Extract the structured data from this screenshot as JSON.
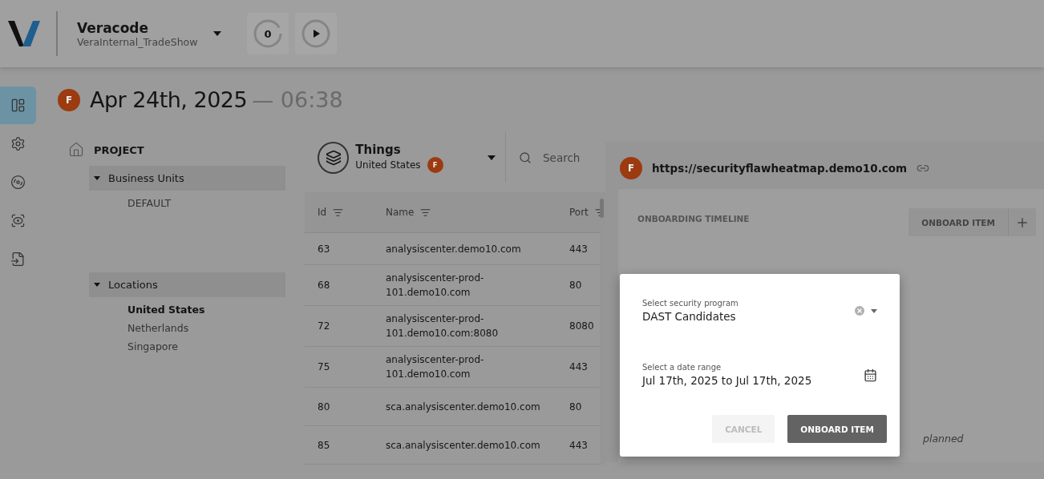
{
  "header": {
    "org": "Veracode",
    "workspace": "VeraInternal_TradeShow",
    "counter": "0"
  },
  "rail": [
    {
      "kind": "dashboard",
      "selected": true
    },
    {
      "kind": "settings",
      "selected": false
    },
    {
      "kind": "target",
      "selected": false
    },
    {
      "kind": "scan",
      "selected": false
    },
    {
      "kind": "import",
      "selected": false
    }
  ],
  "date": {
    "avatar": "F",
    "date": "Apr 24th, 2025",
    "time": "— 06:38"
  },
  "project": {
    "title": "PROJECT",
    "groups": [
      {
        "label": "Business Units",
        "expanded": true,
        "children": [
          {
            "label": "DEFAULT",
            "selected": false
          }
        ]
      },
      {
        "label": "Locations",
        "expanded": true,
        "children": [
          {
            "label": "United States",
            "selected": true
          },
          {
            "label": "Netherlands",
            "selected": false
          },
          {
            "label": "Singapore",
            "selected": false
          }
        ]
      }
    ]
  },
  "things": {
    "title": "Things",
    "subtitle": "United States",
    "badge": "F",
    "search_placeholder": "Search",
    "columns": [
      "Id",
      "Name",
      "Port"
    ],
    "rows": [
      {
        "id": "63",
        "name": "analysiscenter.demo10.com",
        "port": "443"
      },
      {
        "id": "68",
        "name": "analysiscenter-prod-101.demo10.com",
        "port": "80"
      },
      {
        "id": "72",
        "name": "analysiscenter-prod-101.demo10.com:8080",
        "port": "8080"
      },
      {
        "id": "75",
        "name": "analysiscenter-prod-101.demo10.com",
        "port": "443"
      },
      {
        "id": "80",
        "name": "sca.analysiscenter.demo10.com",
        "port": "80"
      },
      {
        "id": "85",
        "name": "sca.analysiscenter.demo10.com",
        "port": "443"
      }
    ]
  },
  "detail": {
    "avatar": "F",
    "url": "https://securityflawheatmap.demo10.com",
    "timeline_title": "ONBOARDING TIMELINE",
    "onboard_button": "ONBOARD ITEM",
    "empty_note": "planned"
  },
  "dialog": {
    "program_label": "Select security program",
    "program_value": "DAST Candidates",
    "date_label": "Select a date range",
    "date_value": "Jul 17th, 2025 to Jul 17th, 2025",
    "cancel": {
      "label": "CANCEL",
      "disabled": true
    },
    "confirm": "ONBOARD ITEM"
  }
}
